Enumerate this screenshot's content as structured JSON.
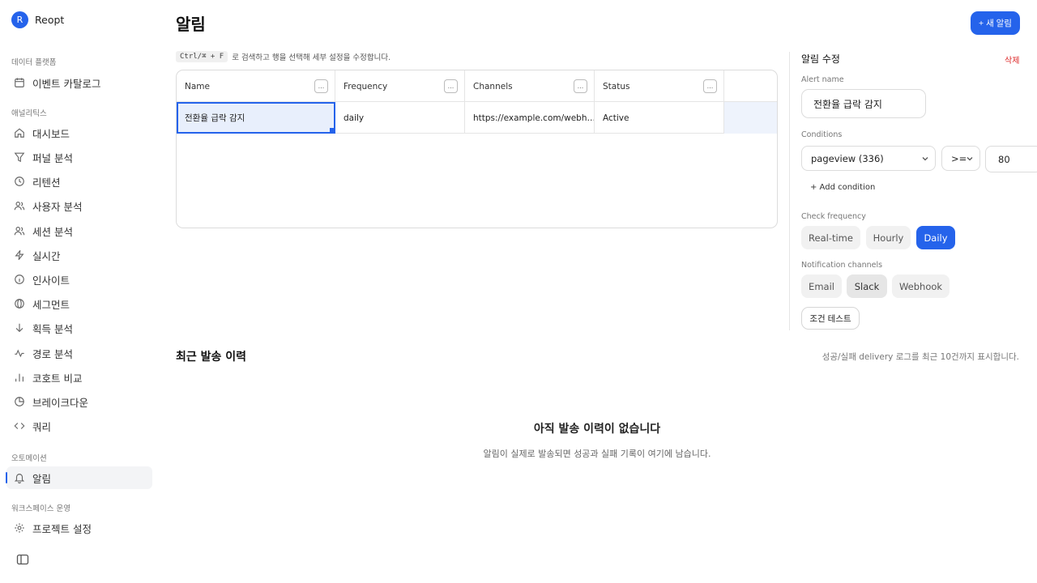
{
  "brand": {
    "initial": "R",
    "name": "Reopt"
  },
  "sidebar": {
    "sections": [
      {
        "label": "데이터 플랫폼"
      },
      {
        "label": "애널리틱스"
      },
      {
        "label": "오토메이션"
      },
      {
        "label": "워크스페이스 운영"
      }
    ],
    "items": [
      {
        "label": "이벤트 카탈로그",
        "icon": "calendar-icon"
      },
      {
        "label": "대시보드",
        "icon": "home-icon"
      },
      {
        "label": "퍼널 분석",
        "icon": "funnel-icon"
      },
      {
        "label": "리텐션",
        "icon": "clock-icon"
      },
      {
        "label": "사용자 분석",
        "icon": "users-icon"
      },
      {
        "label": "세션 분석",
        "icon": "users-icon"
      },
      {
        "label": "실시간",
        "icon": "lightning-icon"
      },
      {
        "label": "인사이트",
        "icon": "info-icon"
      },
      {
        "label": "세그먼트",
        "icon": "globe-icon"
      },
      {
        "label": "획득 분석",
        "icon": "arrow-down-icon"
      },
      {
        "label": "경로 분석",
        "icon": "path-icon"
      },
      {
        "label": "코호트 비교",
        "icon": "bar-chart-icon"
      },
      {
        "label": "브레이크다운",
        "icon": "pie-icon"
      },
      {
        "label": "쿼리",
        "icon": "code-icon"
      },
      {
        "label": "알림",
        "icon": "bell-icon"
      },
      {
        "label": "프로젝트 설정",
        "icon": "gear-icon"
      }
    ]
  },
  "page": {
    "title": "알림",
    "new_button": "+ 새 알림",
    "hint_kbd": "Ctrl/⌘ + F",
    "hint_text": "로 검색하고 행을 선택해 세부 설정을 수정합니다."
  },
  "grid": {
    "columns": [
      "Name",
      "Frequency",
      "Channels",
      "Status"
    ],
    "menu_glyph": "...",
    "rows": [
      {
        "name": "전환율 급락 감지",
        "frequency": "daily",
        "channels": "https://example.com/webh…",
        "status": "Active"
      }
    ]
  },
  "panel": {
    "title": "알림 수정",
    "delete": "삭제",
    "alert_name_label": "Alert name",
    "alert_name_value": "전환율 급락 감지",
    "conditions_label": "Conditions",
    "condition_event": "pageview (336)",
    "condition_operator": ">=",
    "condition_value": "80",
    "add_condition": "+ Add condition",
    "frequency_label": "Check frequency",
    "frequency_options": [
      "Real-time",
      "Hourly",
      "Daily"
    ],
    "frequency_selected": "Daily",
    "channels_label": "Notification channels",
    "channel_options": [
      "Email",
      "Slack",
      "Webhook"
    ],
    "test_button": "조건 테스트"
  },
  "history": {
    "title": "최근 발송 이력",
    "hint": "성공/실패 delivery 로그를 최근 10건까지 표시합니다.",
    "empty_title": "아직 발송 이력이 없습니다",
    "empty_sub": "알림이 실제로 발송되면 성공과 실패 기록이 여기에 남습니다."
  },
  "colors": {
    "accent": "#2563eb",
    "danger": "#dc2626"
  }
}
